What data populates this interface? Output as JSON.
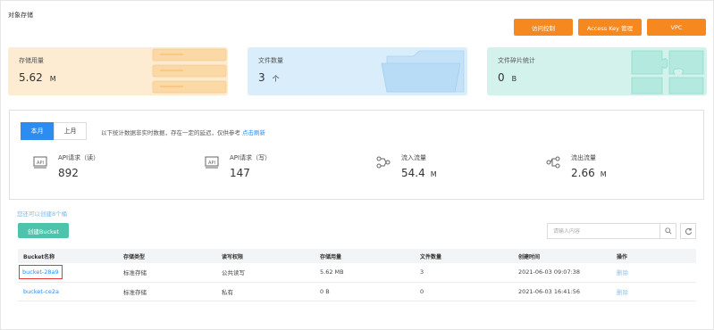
{
  "page_title": "对象存储",
  "top_buttons": [
    {
      "label": "访问控制"
    },
    {
      "label": "Access Key 管理"
    },
    {
      "label": "VPC"
    }
  ],
  "summary_cards": [
    {
      "label": "存储用量",
      "value": "5.62",
      "unit": "M",
      "color": "#fdebd2"
    },
    {
      "label": "文件数量",
      "value": "3",
      "unit": "个",
      "color": "#d9edfb"
    },
    {
      "label": "文件碎片统计",
      "value": "0",
      "unit": "B",
      "color": "#d3f2ec"
    }
  ],
  "stats": {
    "tabs": [
      {
        "label": "本月",
        "active": true
      },
      {
        "label": "上月",
        "active": false
      }
    ],
    "notice": "以下统计数据非实时数据，存在一定的延迟，仅供参考",
    "notice_link": "点击刷新",
    "metrics": [
      {
        "label": "API请求（读）",
        "value": "892",
        "unit": "",
        "icon": "api-icon"
      },
      {
        "label": "API请求（写）",
        "value": "147",
        "unit": "",
        "icon": "api-icon"
      },
      {
        "label": "流入流量",
        "value": "54.4",
        "unit": "M",
        "icon": "flow-in-icon"
      },
      {
        "label": "流出流量",
        "value": "2.66",
        "unit": "M",
        "icon": "flow-out-icon"
      }
    ]
  },
  "bucket_hint": "您还可以创建8个桶",
  "create_button": "创建Bucket",
  "search": {
    "placeholder": "请输入内容"
  },
  "table": {
    "headers": [
      "Bucket名称",
      "存储类型",
      "读写权限",
      "存储用量",
      "文件数量",
      "创建时间",
      "操作"
    ],
    "rows": [
      [
        "bucket-28a9",
        "标准存储",
        "公共读写",
        "5.62 MB",
        "3",
        "2021-06-03 09:07:38",
        "删除"
      ],
      [
        "bucket-ce2a",
        "标准存储",
        "私有",
        "0 B",
        "0",
        "2021-06-03 16:41:56",
        "删除"
      ]
    ]
  },
  "colors": {
    "accent_orange": "#f5891f",
    "primary_blue": "#2d8cf0",
    "create_green": "#4fc2ac",
    "highlight_red": "#e53935"
  }
}
